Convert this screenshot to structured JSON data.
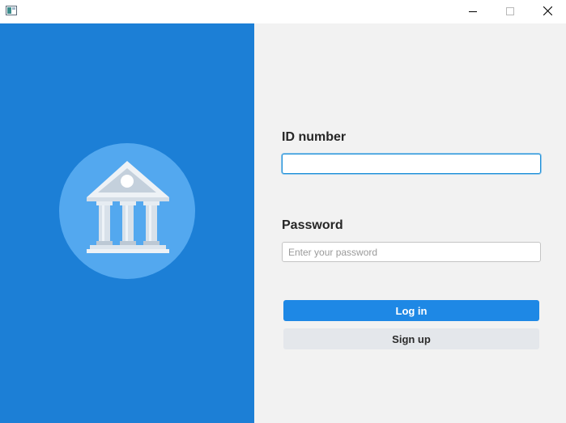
{
  "window": {
    "title": "",
    "app_icon": "window-app-icon",
    "controls": {
      "minimize_icon": "minimize-icon",
      "maximize_icon": "maximize-icon",
      "close_icon": "close-icon"
    }
  },
  "left_panel": {
    "background_color": "#1c7fd6",
    "logo_icon": "bank-building-icon",
    "logo_circle_color": "#53a8ef"
  },
  "form": {
    "id_label": "ID number",
    "id_value": "",
    "id_placeholder": "",
    "password_label": "Password",
    "password_value": "",
    "password_placeholder": "Enter your password",
    "login_label": "Log in",
    "signup_label": "Sign up",
    "accent_color": "#1e88e5"
  }
}
